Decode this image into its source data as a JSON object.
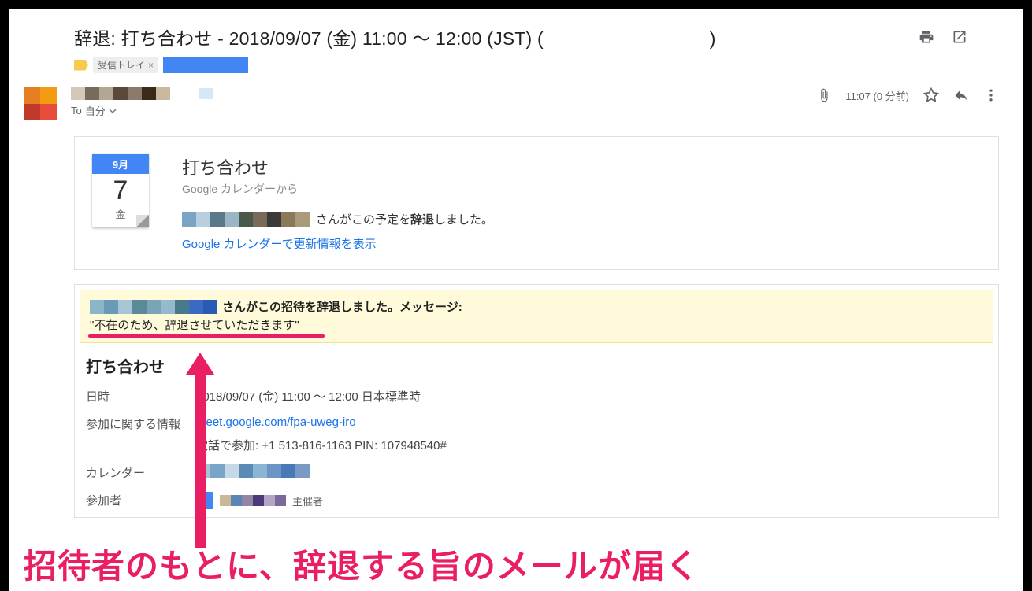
{
  "subject": "辞退: 打ち合わせ - 2018/09/07 (金) 11:00 ～ 12:00 (JST) (",
  "subject_end": ")",
  "labels": {
    "inbox": "受信トレイ"
  },
  "header": {
    "to_prefix": "To",
    "to_self": "自分",
    "timestamp": "11:07 (0 分前)"
  },
  "calendar_tile": {
    "month": "9月",
    "day": "7",
    "dow": "金"
  },
  "card": {
    "title": "打ち合わせ",
    "from": "Google カレンダーから",
    "decline_mid": " さんがこの予定を",
    "decline_bold": "辞退",
    "decline_end": "しました。",
    "view_link": "Google カレンダーで更新情報を表示"
  },
  "notice": {
    "line1": " さんがこの招待を辞退しました。メッセージ:",
    "message": "\"不在のため、辞退させていただきます\""
  },
  "details": {
    "title": "打ち合わせ",
    "rows": {
      "datetime_label": "日時",
      "datetime_value": "2018/09/07 (金) 11:00 ～ 12:00 日本標準時",
      "join_label": "参加に関する情報",
      "meet_link": "meet.google.com/fpa-uweg-iro",
      "phone": "電話で参加: +1 513-816-1163  PIN: 107948540#",
      "calendar_label": "カレンダー",
      "participants_label": "参加者",
      "organizer": "主催者"
    }
  },
  "annotation": "招待者のもとに、辞退する旨のメールが届く"
}
